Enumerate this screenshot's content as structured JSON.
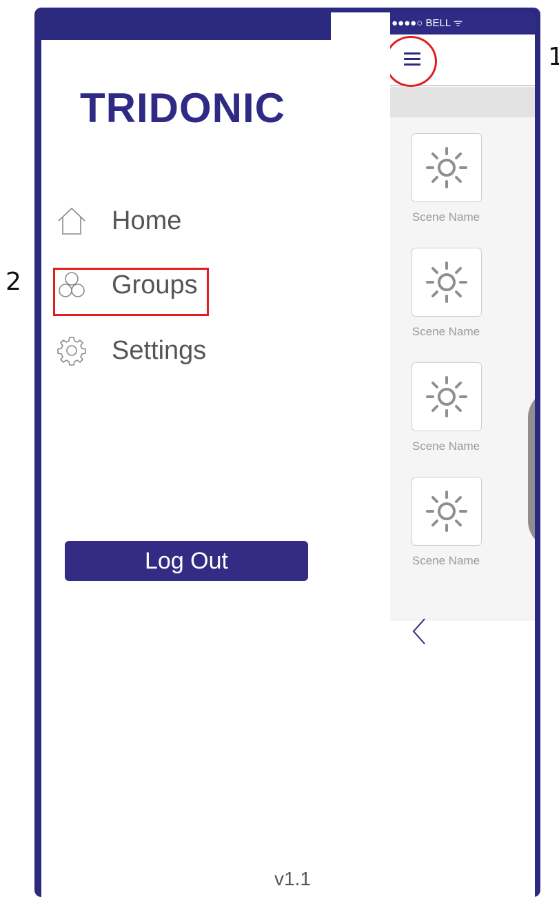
{
  "callouts": [
    "1",
    "2"
  ],
  "status_bar": {
    "carrier": "●●●●○ BELL ᯤ"
  },
  "drawer": {
    "logo": "TRIDONIC",
    "nav": [
      {
        "label": "Home",
        "icon": "home-icon"
      },
      {
        "label": "Groups",
        "icon": "groups-icon"
      },
      {
        "label": "Settings",
        "icon": "gear-icon"
      }
    ],
    "logout_label": "Log Out",
    "version": "v1.1"
  },
  "scenes": [
    {
      "label": "Scene Name",
      "icon": "sun-icon"
    },
    {
      "label": "Scene Name",
      "icon": "sun-icon"
    },
    {
      "label": "Scene Name",
      "icon": "sun-icon"
    },
    {
      "label": "Scene Name",
      "icon": "sun-icon"
    }
  ],
  "colors": {
    "brand": "#2c2a7e",
    "highlight": "#e01e1e"
  }
}
